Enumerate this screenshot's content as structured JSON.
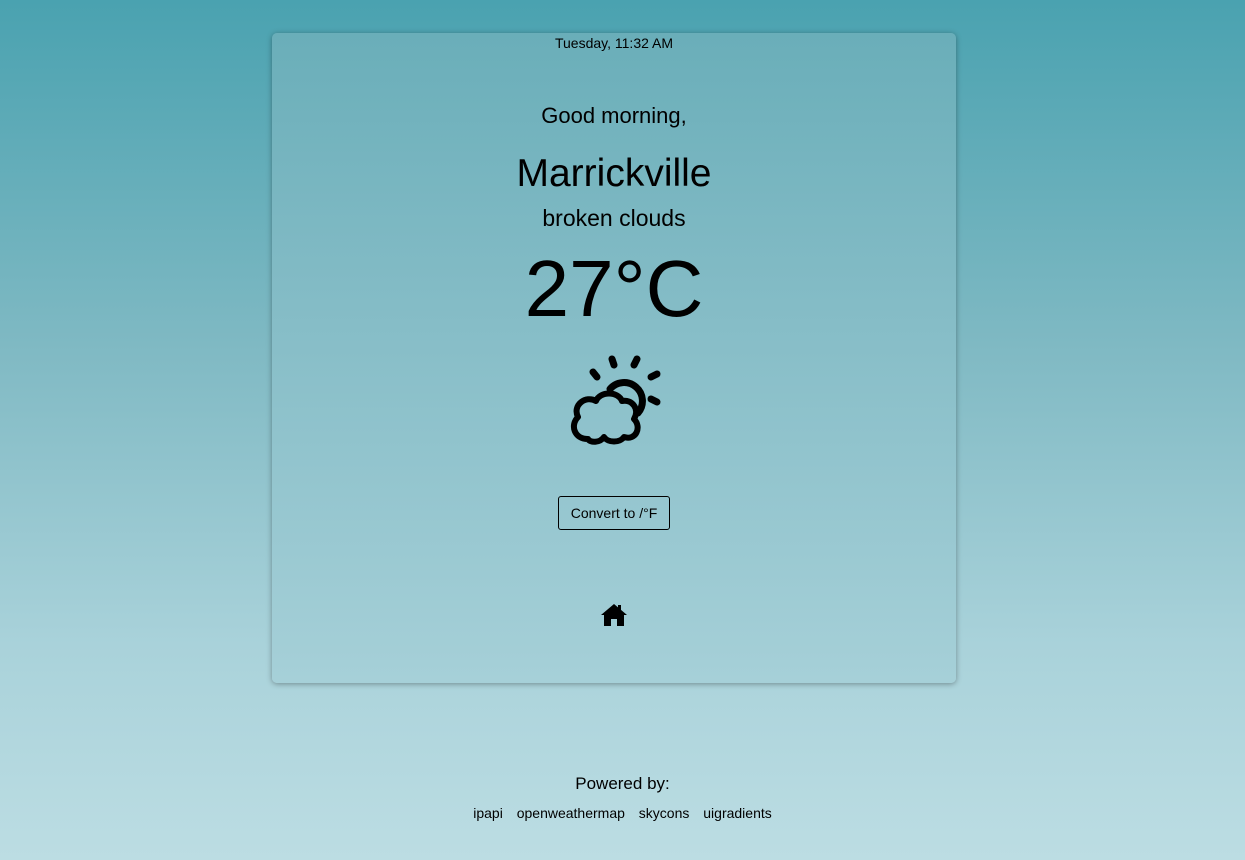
{
  "header": {
    "datetime": "Tuesday, 11:32 AM"
  },
  "weather": {
    "greeting": "Good morning,",
    "city": "Marrickville",
    "description": "broken clouds",
    "temperature": "27°C",
    "icon": "partly-cloudy-day-icon"
  },
  "controls": {
    "convert_label": "Convert to /°F",
    "home_icon": "home-icon"
  },
  "footer": {
    "powered_by": "Powered by:",
    "links": [
      "ipapi",
      "openweathermap",
      "skycons",
      "uigradients"
    ]
  },
  "colors": {
    "background_top": "#4aa2b0",
    "background_bottom": "#bcdde3",
    "card": "#86bdc7"
  }
}
